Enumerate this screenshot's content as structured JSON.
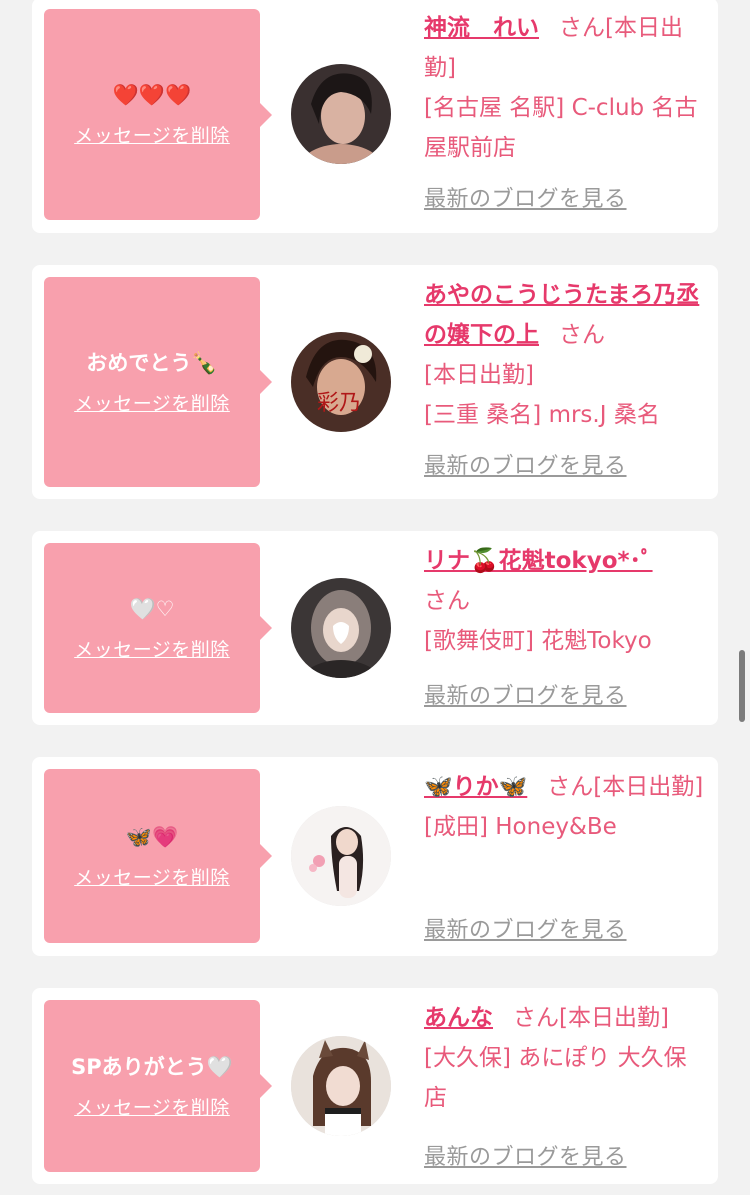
{
  "items": [
    {
      "message": "❤️❤️❤️",
      "delete_label": "メッセージを削除",
      "name": "神流　れい",
      "san": "さん",
      "status": "[本日出勤]",
      "shop": "[名古屋 名駅] C-club 名古屋駅前店",
      "blog_label": "最新のブログを見る"
    },
    {
      "message": "おめでとう🍾",
      "delete_label": "メッセージを削除",
      "name": "あやのこうじうたまろ乃丞の嬢下の上",
      "san": "さん",
      "status": "[本日出勤]",
      "shop": "[三重 桑名] mrs.J 桑名",
      "blog_label": "最新のブログを見る"
    },
    {
      "message": "🤍♡",
      "delete_label": "メッセージを削除",
      "name": "リナ🍒花魁tokyo*･ﾟ",
      "san": "さん",
      "status": "",
      "shop": "[歌舞伎町] 花魁Tokyo",
      "blog_label": "最新のブログを見る"
    },
    {
      "message": "🦋💗",
      "delete_label": "メッセージを削除",
      "name": "🦋りか🦋",
      "san": "さん",
      "status": "[本日出勤]",
      "shop": "[成田] Honey&Be",
      "blog_label": "最新のブログを見る"
    },
    {
      "message": "SPありがとう🤍",
      "delete_label": "メッセージを削除",
      "name": "あんな",
      "san": "さん",
      "status": "[本日出勤]",
      "shop": "[大久保] あにぽり 大久保店",
      "blog_label": "最新のブログを見る"
    }
  ],
  "colors": {
    "bubble": "#f8a0ad",
    "name": "#e6396b",
    "text": "#e85a7b",
    "blog": "#9a9a9a",
    "background": "#f2f2f2"
  }
}
